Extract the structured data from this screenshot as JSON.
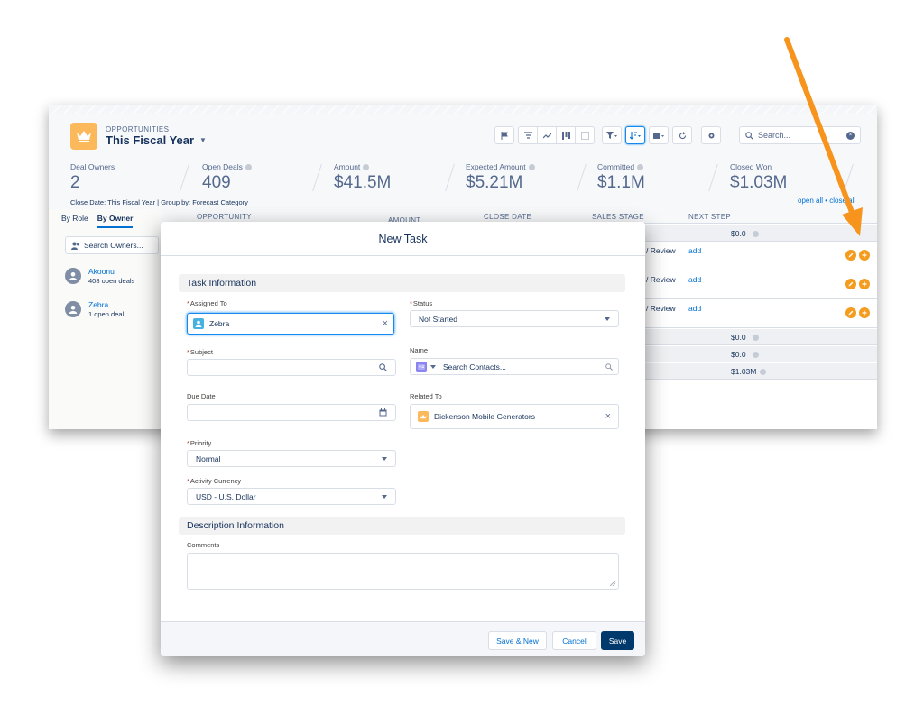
{
  "header": {
    "object_label": "OPPORTUNITIES",
    "list_view": "This Fiscal Year",
    "search_placeholder": "Search..."
  },
  "metrics": [
    {
      "label": "Deal Owners",
      "value": "2"
    },
    {
      "label": "Open Deals",
      "value": "409"
    },
    {
      "label": "Amount",
      "value": "$41.5M"
    },
    {
      "label": "Expected Amount",
      "value": "$5.21M"
    },
    {
      "label": "Committed",
      "value": "$1.1M"
    },
    {
      "label": "Closed Won",
      "value": "$1.03M"
    }
  ],
  "subline": "Close Date: This Fiscal Year  |  Group by: Forecast Category",
  "open_all": "open all • close all",
  "left_panel": {
    "tabs": [
      "By Role",
      "By Owner"
    ],
    "search_placeholder": "Search Owners...",
    "owners": [
      {
        "name": "Akoonu",
        "sub": "408 open deals"
      },
      {
        "name": "Zebra",
        "sub": "1 open deal"
      }
    ]
  },
  "grid": {
    "columns": [
      "OPPORTUNITY",
      "AMOUNT",
      "CLOSE DATE",
      "SALES STAGE",
      "NEXT STEP"
    ],
    "summary_top": "$0.0",
    "rows": [
      {
        "stage": "/ Review",
        "next": "add"
      },
      {
        "stage": "/ Review",
        "next": "add"
      },
      {
        "stage": "/ Review",
        "next": "add"
      }
    ],
    "summary_bottom": [
      "$0.0",
      "$0.0",
      "$1.03M"
    ]
  },
  "modal": {
    "title": "New Task",
    "section_task": "Task Information",
    "assigned_to_label": "Assigned To",
    "assigned_to_value": "Zebra",
    "status_label": "Status",
    "status_value": "Not Started",
    "subject_label": "Subject",
    "name_label": "Name",
    "name_placeholder": "Search Contacts...",
    "due_date_label": "Due Date",
    "related_to_label": "Related To",
    "related_to_value": "Dickenson Mobile Generators",
    "priority_label": "Priority",
    "priority_value": "Normal",
    "currency_label": "Activity Currency",
    "currency_value": "USD - U.S. Dollar",
    "section_description": "Description Information",
    "comments_label": "Comments",
    "save_new_label": "Save & New",
    "cancel_label": "Cancel",
    "save_label": "Save"
  },
  "colors": {
    "brand": "#00396b",
    "accent_orange": "#f39c1f",
    "link": "#0070d2",
    "arrow": "#f7941d"
  }
}
